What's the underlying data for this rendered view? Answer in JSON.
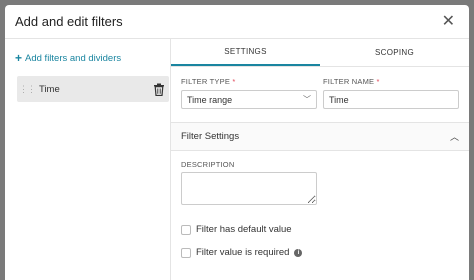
{
  "modal": {
    "title": "Add and edit filters",
    "close_glyph": "✕"
  },
  "sidebar": {
    "add_link": "Add filters and dividers",
    "items": [
      {
        "label": "Time",
        "selected": true
      }
    ]
  },
  "tabs": [
    {
      "label": "SETTINGS",
      "active": true
    },
    {
      "label": "SCOPING",
      "active": false
    }
  ],
  "form": {
    "filter_type_label": "FILTER TYPE",
    "filter_type_value": "Time range",
    "filter_name_label": "FILTER NAME",
    "filter_name_value": "Time",
    "required_marker": "*"
  },
  "filter_settings": {
    "title": "Filter Settings",
    "description_label": "DESCRIPTION",
    "description_value": "",
    "default_value_label": "Filter has default value",
    "default_value_checked": false,
    "required_label": "Filter value is required",
    "required_checked": false
  },
  "colors": {
    "accent": "#1a85a0",
    "required": "#e04355"
  }
}
